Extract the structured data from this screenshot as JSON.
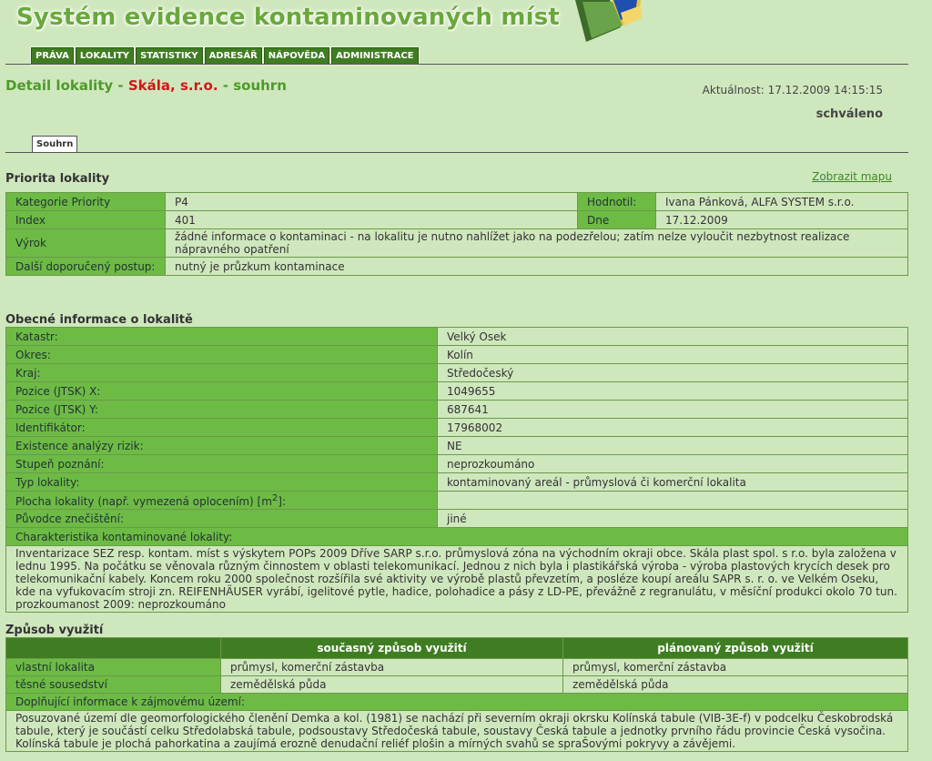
{
  "header": {
    "title": "Systém evidence kontaminovaných míst"
  },
  "menu": [
    "PRÁVA",
    "LOKALITY",
    "STATISTIKY",
    "ADRESÁŘ",
    "NÁPOVĚDA",
    "ADMINISTRACE"
  ],
  "page": {
    "title_prefix": "Detail lokality",
    "sep1": " - ",
    "location": "Skála, s.r.o.",
    "sep2": " - ",
    "title_suffix": "souhrn",
    "aktualnost": "Aktuálnost: 17.12.2009 14:15:15",
    "status": "schváleno",
    "tab": "Souhrn"
  },
  "priorita": {
    "title": "Priorita lokality",
    "map_link": "Zobrazit mapu",
    "rows": [
      {
        "label": "Kategorie Priority",
        "value": "P4"
      },
      {
        "label": "Index",
        "value": "401"
      },
      {
        "label": "Výrok",
        "value": "žádné informace o kontaminaci - na lokalitu je nutno nahlížet jako na podezřelou; zatím nelze vyloučit nezbytnost realizace nápravného opatření"
      },
      {
        "label": "Další doporučený postup:",
        "value": "nutný je průzkum kontaminace"
      }
    ],
    "side": [
      {
        "label": "Hodnotil:",
        "value": "Ivana Pánková, ALFA SYSTEM s.r.o."
      },
      {
        "label": "Dne",
        "value": "17.12.2009"
      }
    ]
  },
  "obecne": {
    "title": "Obecné informace o lokalitě",
    "rows": [
      {
        "label": "Katastr:",
        "value": "Velký Osek"
      },
      {
        "label": "Okres:",
        "value": "Kolín"
      },
      {
        "label": "Kraj:",
        "value": "Středočeský"
      },
      {
        "label": "Pozice (JTSK) X:",
        "value": "1049655"
      },
      {
        "label": "Pozice (JTSK) Y:",
        "value": "687641"
      },
      {
        "label": "Identifikátor:",
        "value": "17968002"
      },
      {
        "label": "Existence analýzy rizik:",
        "value": "NE"
      },
      {
        "label": "Stupeň poznání:",
        "value": "neprozkoumáno"
      },
      {
        "label": "Typ lokality:",
        "value": "kontaminovaný areál - průmyslová či komerční lokalita"
      },
      {
        "label_pre": "Plocha lokality (např. vymezená oplocením) [m",
        "label_sup": "2",
        "label_post": "]:",
        "value": ""
      },
      {
        "label": "Původce znečištění:",
        "value": "jiné"
      }
    ],
    "char_label": "Charakteristika kontaminované lokality:",
    "char_text": "Inventarizace SEZ resp. kontam. míst s výskytem POPs 2009 Dříve SARP s.r.o. průmyslová zóna na východním okraji obce. Skála plast spol. s r.o. byla založena v lednu 1995. Na počátku se věnovala různým činnostem v oblasti telekomunikací. Jednou z nich byla i plastikářská výroba - výroba plastových krycích desek pro telekomunikační kabely. Koncem roku 2000 společnost rozšířila své aktivity ve výrobě plastů převzetím, a posléze koupí areálu SAPR s. r. o. ve Velkém Oseku, kde na vyfukovacím stroji zn. REIFENHÄUSER vyrábí, igelitové pytle, hadice, polohadice a pásy z LD-PE, převážně z regranulátu, v měsíční produkci okolo 70 tun. prozkoumanost 2009: neprozkoumáno"
  },
  "zpusob": {
    "title": "Způsob využití",
    "col_current": "současný způsob využití",
    "col_planned": "plánovaný způsob využití",
    "rows": [
      {
        "label": "vlastní lokalita",
        "current": "průmysl, komerční zástavba",
        "planned": "průmysl, komerční zástavba"
      },
      {
        "label": "těsné sousedství",
        "current": "zemědělská půda",
        "planned": "zemědělská půda"
      }
    ],
    "extra_label": "Doplňující informace k zájmovému území:",
    "extra_text": "Posuzované území dle geomorfologického členění Demka a kol. (1981) se nachází při severním okraji okrsku Kolínská tabule (VIB-3E-f) v podcelku Českobrodská tabule, který je součástí celku Středolabská tabule, podsoustavy Středočeská tabule, soustavy Česká tabule a jednotky prvního řádu provincie Česká vysočina. Kolínská tabule je plochá pahorkatina a zaujímá erozně denudační reliéf plošin a mírných svahů se spraŠovými pokryvy a závějemi."
  }
}
